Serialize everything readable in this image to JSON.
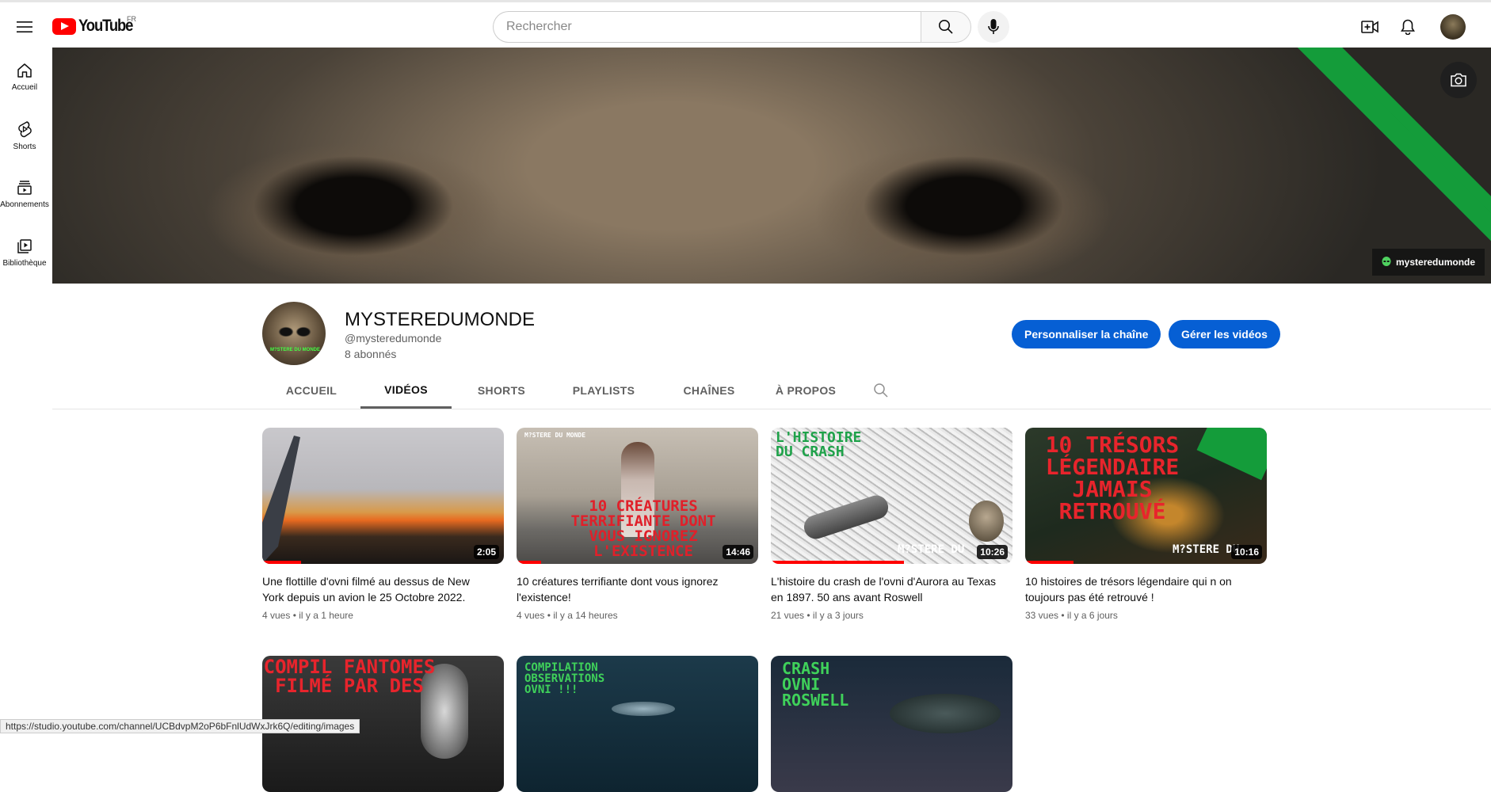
{
  "header": {
    "logo_text": "YouTube",
    "country_code": "FR",
    "search_placeholder": "Rechercher"
  },
  "sidebar": {
    "items": [
      {
        "label": "Accueil",
        "icon": "home-icon"
      },
      {
        "label": "Shorts",
        "icon": "shorts-icon"
      },
      {
        "label": "Abonnements",
        "icon": "subscriptions-icon"
      },
      {
        "label": "Bibliothèque",
        "icon": "library-icon"
      }
    ]
  },
  "banner": {
    "link_label": "mysteredumonde"
  },
  "channel": {
    "name": "MYSTEREDUMONDE",
    "handle": "@mysteredumonde",
    "subscribers": "8 abonnés",
    "avatar_caption": "M?STERE DU MONDE",
    "customize_label": "Personnaliser la chaîne",
    "manage_label": "Gérer les vidéos"
  },
  "tabs": [
    {
      "label": "ACCUEIL",
      "active": false
    },
    {
      "label": "VIDÉOS",
      "active": true
    },
    {
      "label": "SHORTS",
      "active": false
    },
    {
      "label": "PLAYLISTS",
      "active": false
    },
    {
      "label": "CHAÎNES",
      "active": false
    },
    {
      "label": "À PROPOS",
      "active": false
    }
  ],
  "videos": [
    {
      "title": "Une flottille d'ovni filmé au dessus de New York depuis un avion le 25 Octobre 2022.",
      "views": "4 vues",
      "age": "il y a 1 heure",
      "duration": "2:05",
      "thumb_text": "",
      "watched": 0.16
    },
    {
      "title": "10 créatures terrifiante dont vous ignorez l'existence!",
      "views": "4 vues",
      "age": "il y a 14 heures",
      "duration": "14:46",
      "thumb_text": "10 CRÉATURES TERRIFIANTE DONT VOUS IGNOREZ L'EXISTENCE",
      "thumb_tag": "M?STERE DU MONDE",
      "watched": 0.1
    },
    {
      "title": "L'histoire du crash de l'ovni d'Aurora au Texas en 1897. 50 ans avant Roswell",
      "views": "21 vues",
      "age": "il y a 3 jours",
      "duration": "10:26",
      "thumb_text": "L'HISTOIRE DU CRASH",
      "thumb_tag": "M?STERE DU",
      "watched": 0.55
    },
    {
      "title": "10 histoires de trésors légendaire qui n on toujours pas été retrouvé !",
      "views": "33 vues",
      "age": "il y a 6 jours",
      "duration": "10:16",
      "thumb_text": "10 TRÉSORS LÉGENDAIRE JAMAIS RETROUVÉ",
      "thumb_tag": "M?STERE DU",
      "watched": 0.2
    },
    {
      "title": "",
      "thumb_text": "COMPIL FANTOMES FILMÉ PAR DES"
    },
    {
      "title": "",
      "thumb_text": "COMPILATION OBSERVATIONS OVNI !!!"
    },
    {
      "title": "",
      "thumb_text": "CRASH OVNI ROSWELL"
    }
  ],
  "status_url": "https://studio.youtube.com/channel/UCBdvpM2oP6bFnlUdWxJrk6Q/editing/images",
  "colors": {
    "accent_blue": "#065fd4",
    "brand_red": "#ff0000",
    "banner_green": "#149c3a"
  }
}
